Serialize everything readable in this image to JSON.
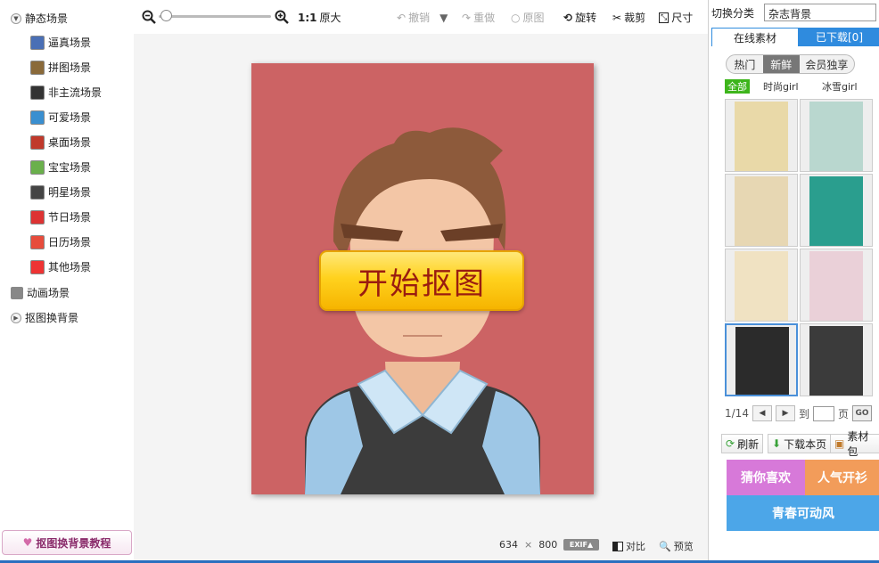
{
  "sidebar": {
    "static_group": "静态场景",
    "items": [
      {
        "label": "逼真场景",
        "color": "#4a6fb5"
      },
      {
        "label": "拼图场景",
        "color": "#8a6a3a"
      },
      {
        "label": "非主流场景",
        "color": "#333333"
      },
      {
        "label": "可爱场景",
        "color": "#3a8fd0"
      },
      {
        "label": "桌面场景",
        "color": "#c0392b"
      },
      {
        "label": "宝宝场景",
        "color": "#6ab04c"
      },
      {
        "label": "明星场景",
        "color": "#444444"
      },
      {
        "label": "节日场景",
        "color": "#d33"
      },
      {
        "label": "日历场景",
        "color": "#e74c3c"
      },
      {
        "label": "其他场景",
        "color": "#e33"
      }
    ],
    "animated": "动画场景",
    "cutout": "抠图换背景",
    "tutorial": "抠图换背景教程"
  },
  "toolbar": {
    "ratio": "1:1",
    "original_size": "原大",
    "undo": "撤销",
    "redo": "重做",
    "original": "原图",
    "rotate": "旋转",
    "crop": "裁剪",
    "size": "尺寸"
  },
  "canvas": {
    "start_button": "开始抠图",
    "bg_color": "#cc6364"
  },
  "status": {
    "width": "634",
    "times": "×",
    "height": "800",
    "exif": "EXIF",
    "compare": "对比",
    "preview": "预览"
  },
  "right": {
    "cat_label": "切换分类",
    "cat_value": "杂志背景",
    "tab_online": "在线素材",
    "tab_downloaded": "已下载[0]",
    "sort": [
      "热门",
      "新鲜",
      "会员独享"
    ],
    "sort_selected": 1,
    "filters": [
      "全部",
      "时尚girl",
      "冰雪girl"
    ],
    "thumb_colors": [
      "#e9d9a8",
      "#b9d7cf",
      "#e7d7b3",
      "#2a9e8e",
      "#f0e2c2",
      "#ead0d8",
      "#2b2b2b",
      "#3b3b3b"
    ],
    "page": "1/14",
    "to": "到",
    "page_unit": "页",
    "go": "GO",
    "refresh": "刷新",
    "download_page": "下载本页",
    "pack": "素材包",
    "banner1": "猜你喜欢",
    "banner2": "人气开衫",
    "banner3": "青春可动风"
  }
}
